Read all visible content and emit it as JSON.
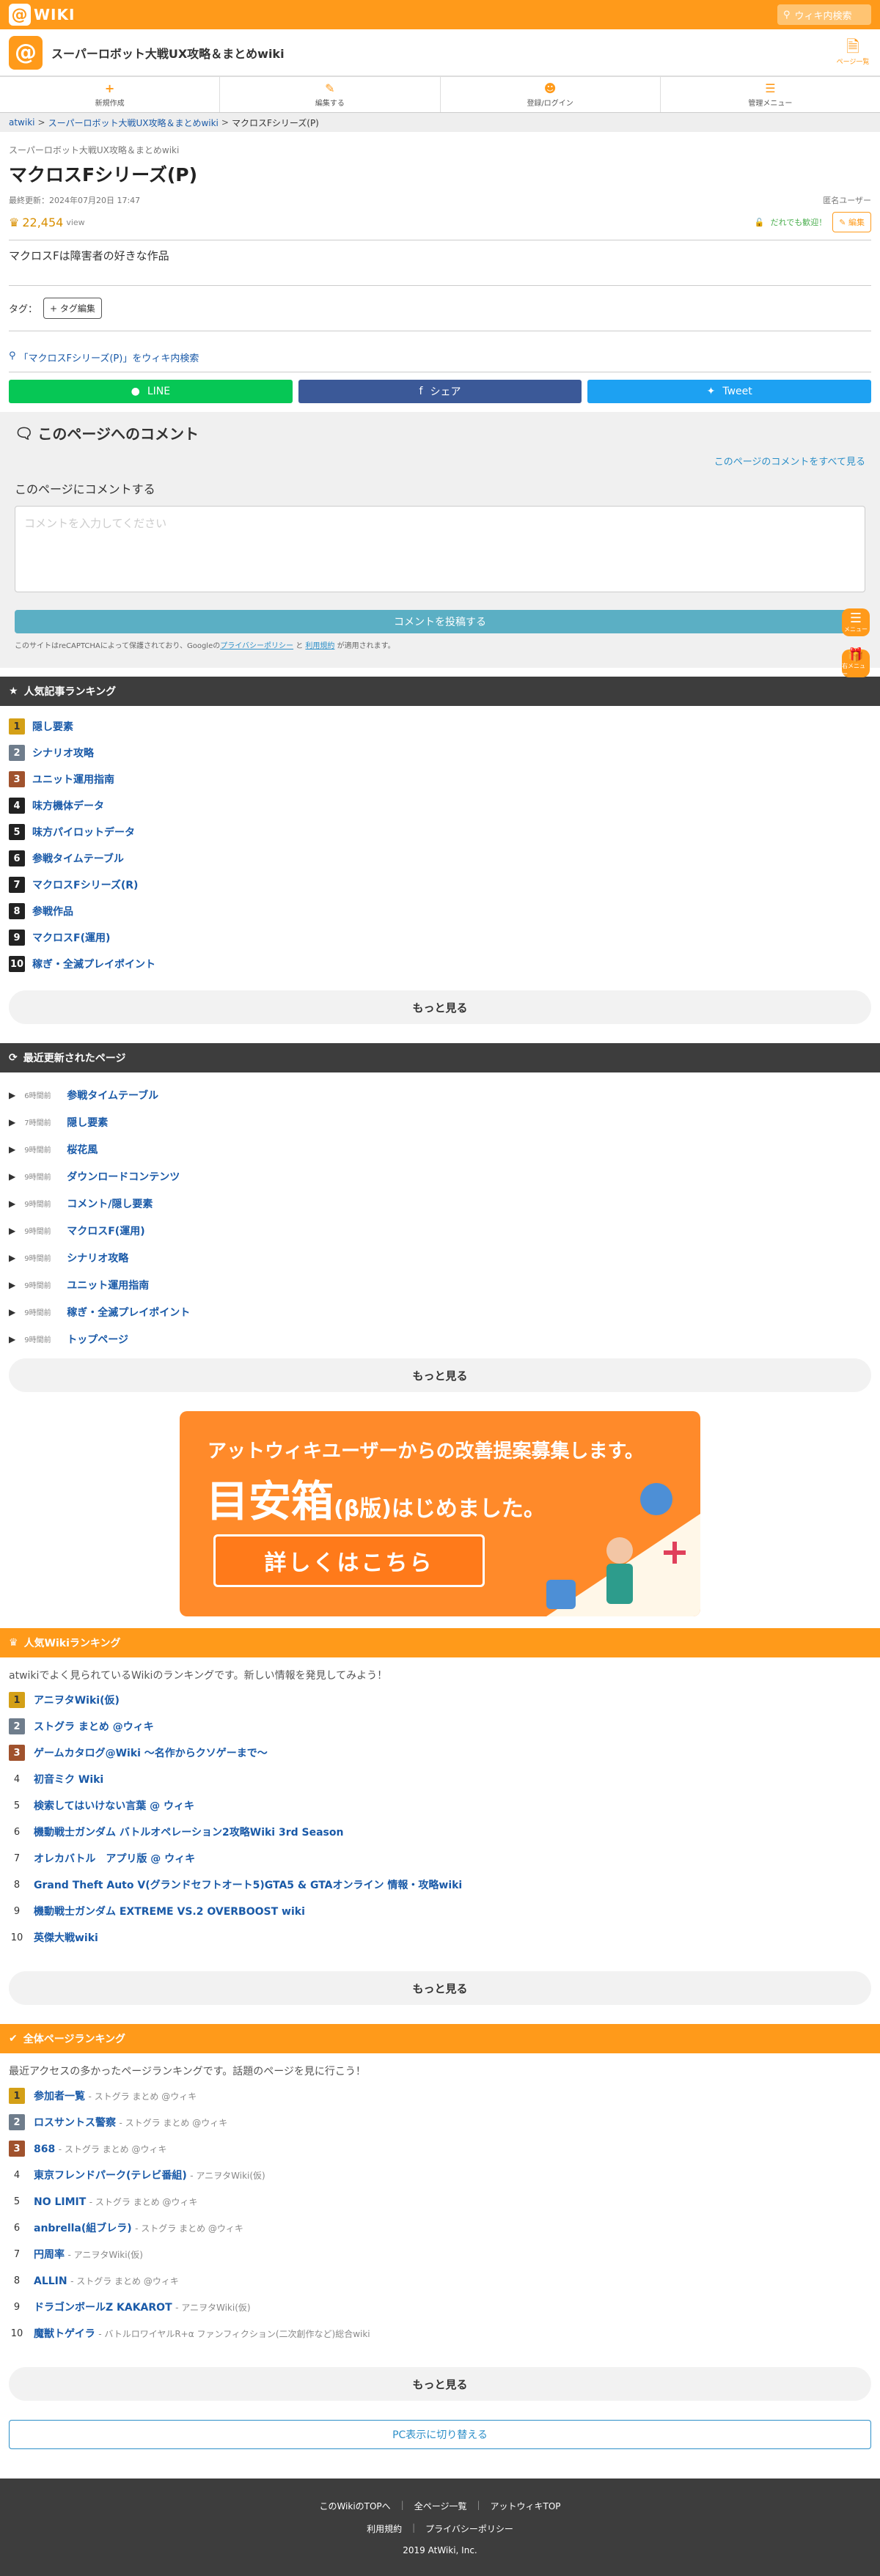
{
  "header": {
    "logo_text": "WIKI",
    "search_placeholder": "ウィキ内検索",
    "site_title": "スーパーロボット大戦UX攻略＆まとめwiki",
    "page_menu": "ページ一覧"
  },
  "toolbar": [
    "新規作成",
    "編集する",
    "登録/ログイン",
    "管理メニュー"
  ],
  "breadcrumb": [
    "atwiki",
    "スーパーロボット大戦UX攻略＆まとめwiki",
    "マクロスFシリーズ(P)"
  ],
  "page": {
    "site_name": "スーパーロボット大戦UX攻略＆まとめwiki",
    "title": "マクロスFシリーズ(P)",
    "last_updated": "最終更新：2024年07月20日 17:47",
    "user": "匿名ユーザー",
    "views": "22,454",
    "views_unit": "view",
    "anyone_welcome": "だれでも歓迎！",
    "edit": "編集",
    "body": "マクロスFは障害者の好きな作品",
    "tag_label": "タグ：",
    "tag_edit": "+ タグ編集",
    "wiki_search": "「マクロスFシリーズ(P)」をウィキ内検索"
  },
  "share": {
    "line": "LINE",
    "facebook": "シェア",
    "twitter": "Tweet"
  },
  "comments": {
    "title": "このページへのコメント",
    "all_link": "このページのコメントをすべて見る",
    "subtitle": "このページにコメントする",
    "placeholder": "コメントを入力してください",
    "post": "コメントを投稿する",
    "note_pre": "このサイトはreCAPTCHAによって保護されており、Googleの",
    "privacy": "プライバシーポリシー",
    "and": "と",
    "terms": "利用規約",
    "note_post": "が適用されます。"
  },
  "popular": {
    "title": "人気記事ランキング",
    "items": [
      "隠し要素",
      "シナリオ攻略",
      "ユニット運用指南",
      "味方機体データ",
      "味方パイロットデータ",
      "参戦タイムテーブル",
      "マクロスFシリーズ(R)",
      "参戦作品",
      "マクロスF(運用)",
      "稼ぎ・全滅プレイポイント"
    ],
    "more": "もっと見る"
  },
  "recent": {
    "title": "最近更新されたページ",
    "items": [
      {
        "time": "6時間前",
        "name": "参戦タイムテーブル"
      },
      {
        "time": "7時間前",
        "name": "隠し要素"
      },
      {
        "time": "9時間前",
        "name": "桜花風"
      },
      {
        "time": "9時間前",
        "name": "ダウンロードコンテンツ"
      },
      {
        "time": "9時間前",
        "name": "コメント/隠し要素"
      },
      {
        "time": "9時間前",
        "name": "マクロスF(運用)"
      },
      {
        "time": "9時間前",
        "name": "シナリオ攻略"
      },
      {
        "time": "9時間前",
        "name": "ユニット運用指南"
      },
      {
        "time": "9時間前",
        "name": "稼ぎ・全滅プレイポイント"
      },
      {
        "time": "9時間前",
        "name": "トップページ"
      }
    ],
    "more": "もっと見る"
  },
  "banner": {
    "line1": "アットウィキユーザーからの改善提案募集します。",
    "line2": "目安箱",
    "beta": "(β版)",
    "line2b": "はじめました。",
    "button": "詳しくはこちら"
  },
  "wiki_ranking": {
    "title": "人気Wikiランキング",
    "desc": "atwikiでよく見られているWikiのランキングです。新しい情報を発見してみよう！",
    "items": [
      "アニヲタWiki(仮)",
      "ストグラ まとめ @ウィキ",
      "ゲームカタログ@Wiki ～名作からクソゲーまで～",
      "初音ミク Wiki",
      "検索してはいけない言葉 @ ウィキ",
      "機動戦士ガンダム バトルオペレーション2攻略Wiki 3rd Season",
      "オレカバトル　アプリ版 @ ウィキ",
      "Grand Theft Auto V(グランドセフトオート5)GTA5 & GTAオンライン 情報・攻略wiki",
      "機動戦士ガンダム EXTREME VS.2 OVERBOOST wiki",
      "英傑大戦wiki"
    ],
    "more": "もっと見る"
  },
  "page_ranking": {
    "title": "全体ページランキング",
    "desc": "最近アクセスの多かったページランキングです。話題のページを見に行こう！",
    "items": [
      {
        "name": "参加者一覧",
        "src": "- ストグラ まとめ @ウィキ"
      },
      {
        "name": "ロスサントス警察",
        "src": "- ストグラ まとめ @ウィキ"
      },
      {
        "name": "868",
        "src": "- ストグラ まとめ @ウィキ"
      },
      {
        "name": "東京フレンドパーク(テレビ番組)",
        "src": "- アニヲタWiki(仮)"
      },
      {
        "name": "NO LIMIT",
        "src": "- ストグラ まとめ @ウィキ"
      },
      {
        "name": "anbrella(組ブレラ)",
        "src": "- ストグラ まとめ @ウィキ"
      },
      {
        "name": "円周率",
        "src": "- アニヲタWiki(仮)"
      },
      {
        "name": "ALLIN",
        "src": "- ストグラ まとめ @ウィキ"
      },
      {
        "name": "ドラゴンボールZ KAKAROT",
        "src": "- アニヲタWiki(仮)"
      },
      {
        "name": "魔獣トゲイラ",
        "src": "- バトルロワイヤルR+α ファンフィクション(二次創作など)総合wiki"
      }
    ],
    "more": "もっと見る"
  },
  "pc_switch": "PC表示に切り替える",
  "footer": {
    "links1": [
      "このWikiのTOPへ",
      "全ページ一覧",
      "アットウィキTOP"
    ],
    "links2": [
      "利用規約",
      "プライバシーポリシー"
    ],
    "copyright": "2019 AtWiki, Inc."
  },
  "float": {
    "menu": "メニュー",
    "ranking": "右メニュー"
  }
}
